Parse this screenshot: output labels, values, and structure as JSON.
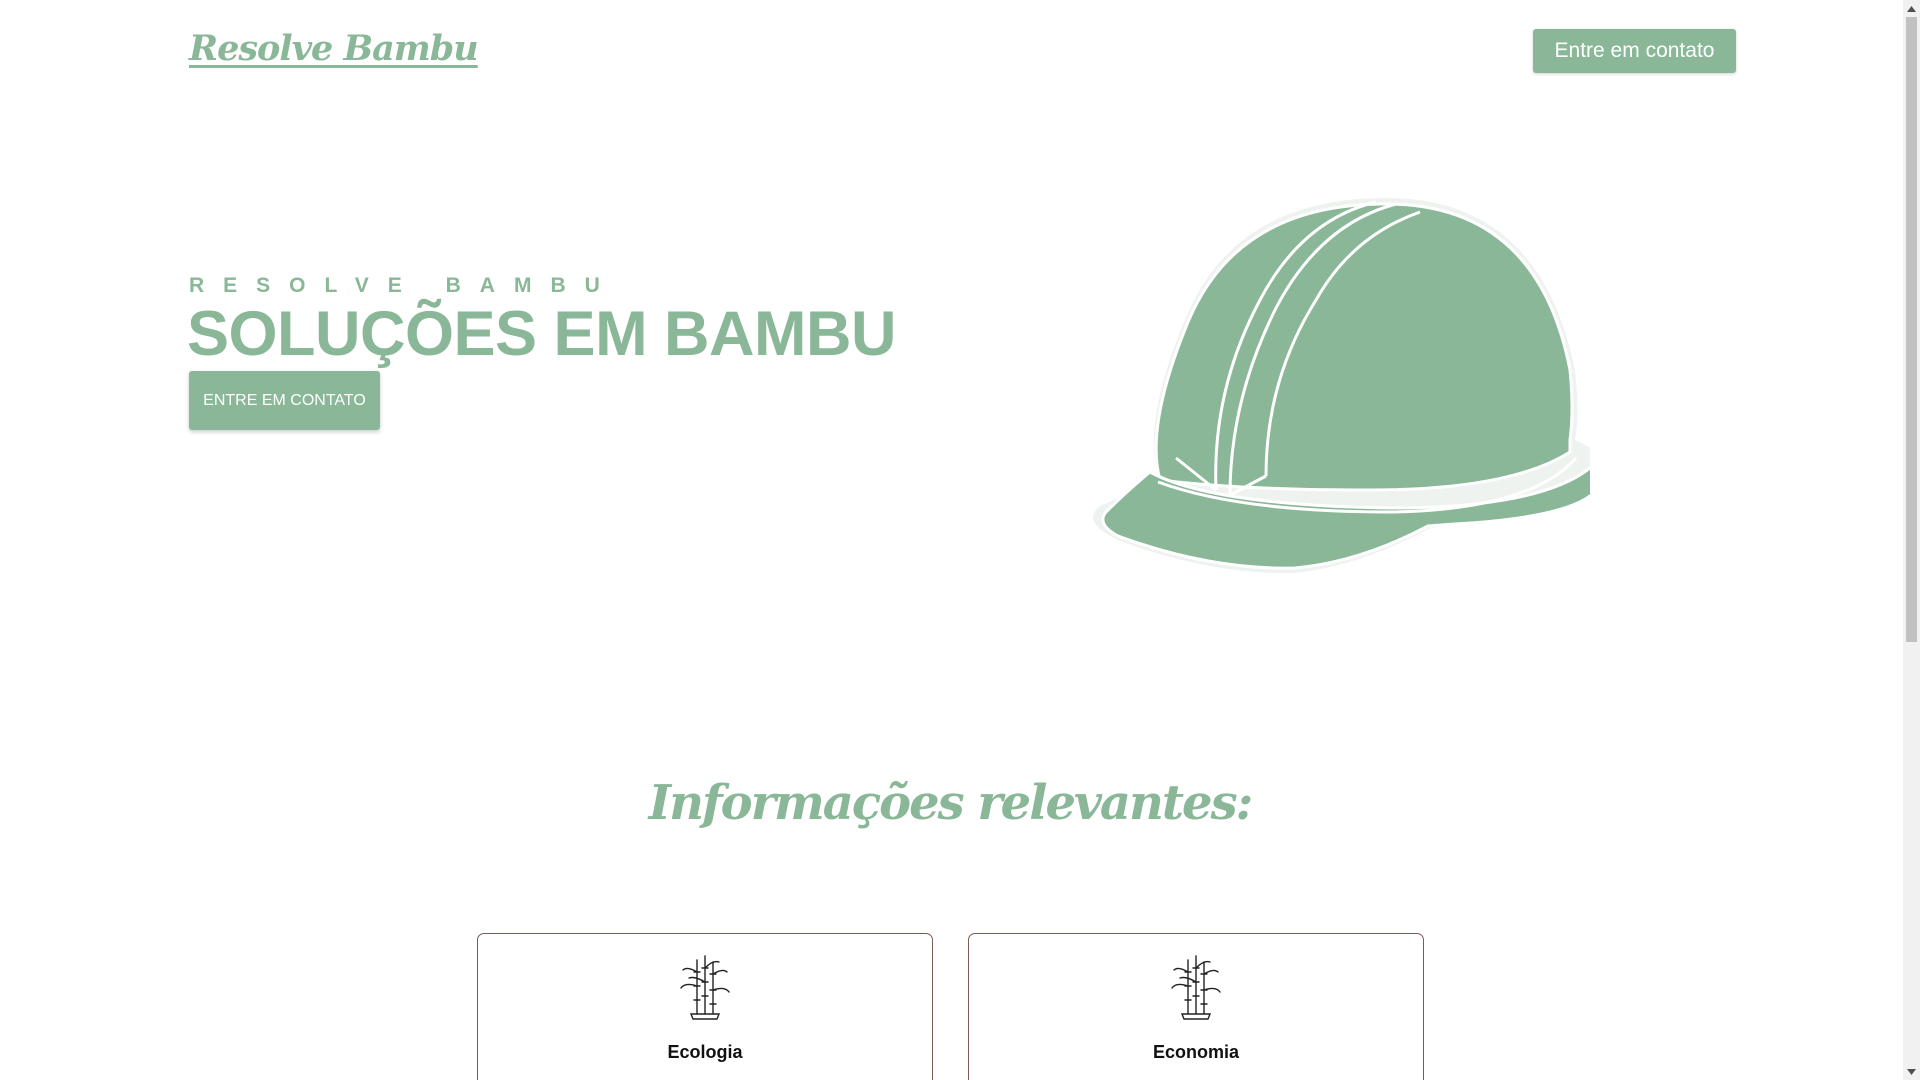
{
  "header": {
    "logo": "Resolve Bambu",
    "cta_label": "Entre em contato"
  },
  "hero": {
    "eyebrow": "RESOLVE BAMBU",
    "title": "SOLUÇÕES EM BAMBU",
    "cta_label": "ENTRE EM CONTATO",
    "image_icon": "hard-hat-icon"
  },
  "info": {
    "title": "Informações relevantes:",
    "cards": [
      {
        "icon": "bamboo-icon",
        "title": "Ecologia"
      },
      {
        "icon": "bamboo-icon",
        "title": "Economia"
      }
    ]
  },
  "colors": {
    "accent": "#89b797",
    "card_border": "#7a5c55",
    "text_dark": "#111111",
    "background": "#ffffff"
  }
}
